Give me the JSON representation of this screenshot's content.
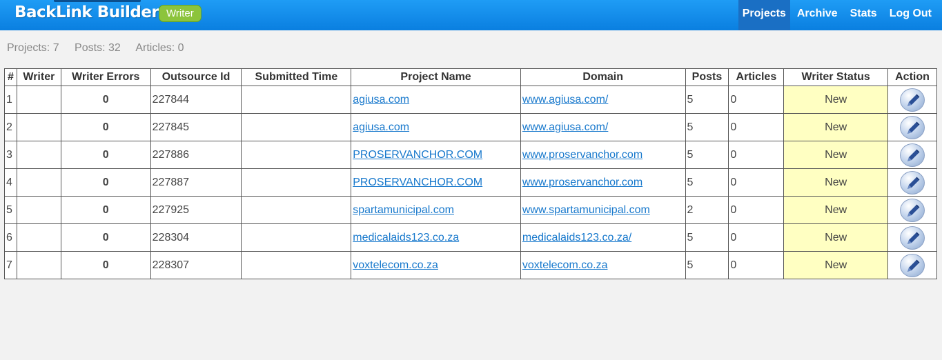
{
  "header": {
    "brand": "BackLink Builder",
    "role_badge": "Writer",
    "nav": [
      {
        "label": "Projects",
        "active": true
      },
      {
        "label": "Archive",
        "active": false
      },
      {
        "label": "Stats",
        "active": false
      },
      {
        "label": "Log Out",
        "active": false
      }
    ]
  },
  "summary": {
    "projects": "Projects: 7",
    "posts": "Posts: 32",
    "articles": "Articles: 0"
  },
  "table": {
    "columns": [
      "#",
      "Writer",
      "Writer Errors",
      "Outsource Id",
      "Submitted Time",
      "Project Name",
      "Domain",
      "Posts",
      "Articles",
      "Writer Status",
      "Action"
    ],
    "rows": [
      {
        "num": "1",
        "writer": "",
        "errors": "0",
        "outsource_id": "227844",
        "submitted": "",
        "project": "agiusa.com",
        "domain": "www.agiusa.com/",
        "posts": "5",
        "articles": "0",
        "status": "New",
        "action_icon": "pencil-icon"
      },
      {
        "num": "2",
        "writer": "",
        "errors": "0",
        "outsource_id": "227845",
        "submitted": "",
        "project": "agiusa.com",
        "domain": "www.agiusa.com/",
        "posts": "5",
        "articles": "0",
        "status": "New",
        "action_icon": "pencil-icon"
      },
      {
        "num": "3",
        "writer": "",
        "errors": "0",
        "outsource_id": "227886",
        "submitted": "",
        "project": "PROSERVANCHOR.COM",
        "domain": "www.proservanchor.com",
        "posts": "5",
        "articles": "0",
        "status": "New",
        "action_icon": "pencil-icon"
      },
      {
        "num": "4",
        "writer": "",
        "errors": "0",
        "outsource_id": "227887",
        "submitted": "",
        "project": "PROSERVANCHOR.COM",
        "domain": "www.proservanchor.com",
        "posts": "5",
        "articles": "0",
        "status": "New",
        "action_icon": "pencil-icon"
      },
      {
        "num": "5",
        "writer": "",
        "errors": "0",
        "outsource_id": "227925",
        "submitted": "",
        "project": "spartamunicipal.com",
        "domain": "www.spartamunicipal.com",
        "posts": "2",
        "articles": "0",
        "status": "New",
        "action_icon": "pencil-icon"
      },
      {
        "num": "6",
        "writer": "",
        "errors": "0",
        "outsource_id": "228304",
        "submitted": "",
        "project": "medicalaids123.co.za",
        "domain": "medicalaids123.co.za/",
        "posts": "5",
        "articles": "0",
        "status": "New",
        "action_icon": "pencil-icon"
      },
      {
        "num": "7",
        "writer": "",
        "errors": "0",
        "outsource_id": "228307",
        "submitted": "",
        "project": "voxtelecom.co.za",
        "domain": "voxtelecom.co.za",
        "posts": "5",
        "articles": "0",
        "status": "New",
        "action_icon": "pencil-icon"
      }
    ]
  },
  "colors": {
    "header_blue": "#0a7fe0",
    "active_nav": "#1a6fc4",
    "badge_green": "#8cc43c",
    "status_yellow": "#ffffc2",
    "link_blue": "#1778cc"
  }
}
